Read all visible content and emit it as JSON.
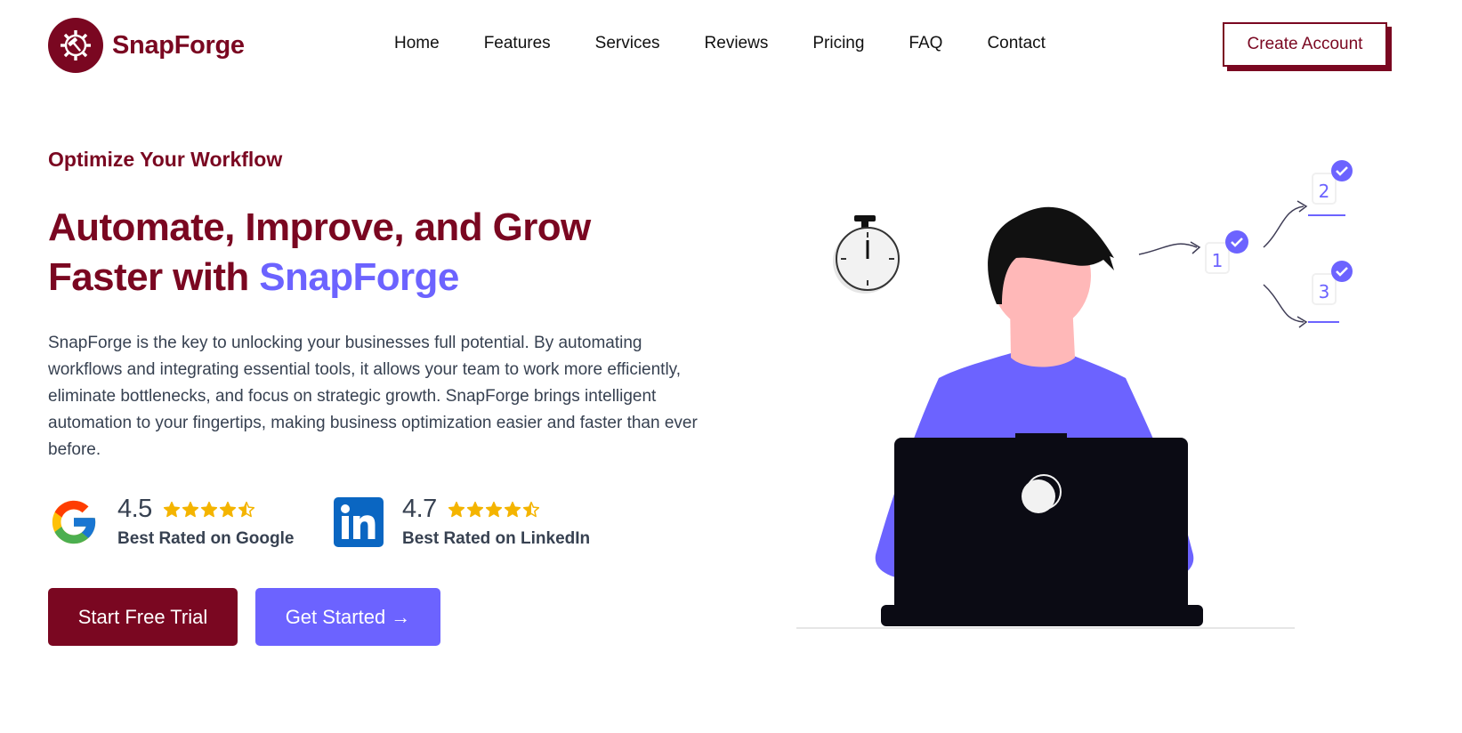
{
  "brand": {
    "name": "SnapForge",
    "color": "#7a0721"
  },
  "nav": {
    "items": [
      {
        "label": "Home"
      },
      {
        "label": "Features"
      },
      {
        "label": "Services"
      },
      {
        "label": "Reviews"
      },
      {
        "label": "Pricing"
      },
      {
        "label": "FAQ"
      },
      {
        "label": "Contact"
      }
    ],
    "cta_label": "Create Account"
  },
  "hero": {
    "eyebrow": "Optimize Your Workflow",
    "headline_line1": "Automate, Improve, and Grow",
    "headline_line2_prefix": "Faster with ",
    "headline_accent": "SnapForge",
    "description": "SnapForge is the key to unlocking your businesses full potential. By automating workflows and integrating essential tools, it allows your team to work more efficiently, eliminate bottlenecks, and focus on strategic growth. SnapForge brings intelligent automation to your fingertips, making business optimization easier and faster than ever before.",
    "accent_color": "#6c63ff"
  },
  "ratings": [
    {
      "platform_icon": "google-icon",
      "score": "4.5",
      "stars": 4.5,
      "caption": "Best Rated on Google"
    },
    {
      "platform_icon": "linkedin-icon",
      "score": "4.7",
      "stars": 4.5,
      "caption": "Best Rated on LinkedIn"
    }
  ],
  "buttons": {
    "start_trial": "Start Free Trial",
    "get_started": "Get Started →"
  },
  "illustration": {
    "icon": "person-at-laptop-illustration",
    "steps": [
      "1",
      "2",
      "3"
    ]
  }
}
